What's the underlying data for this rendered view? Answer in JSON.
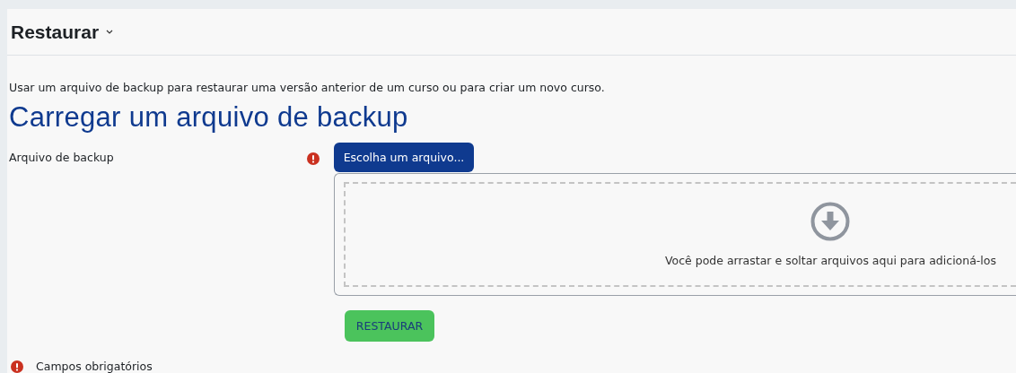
{
  "header": {
    "title": "Restaurar",
    "has_menu": true
  },
  "intro": "Usar um arquivo de backup para restaurar uma versão anterior de um curso ou para criar um novo curso.",
  "section_title": "Carregar um arquivo de backup",
  "field": {
    "label": "Arquivo de backup",
    "required": true,
    "choose_button": "Escolha um arquivo...",
    "dropzone_hint": "Você pode arrastar e soltar arquivos aqui para adicioná-los"
  },
  "submit_button": "RESTAURAR",
  "required_note": "Campos obrigatórios"
}
